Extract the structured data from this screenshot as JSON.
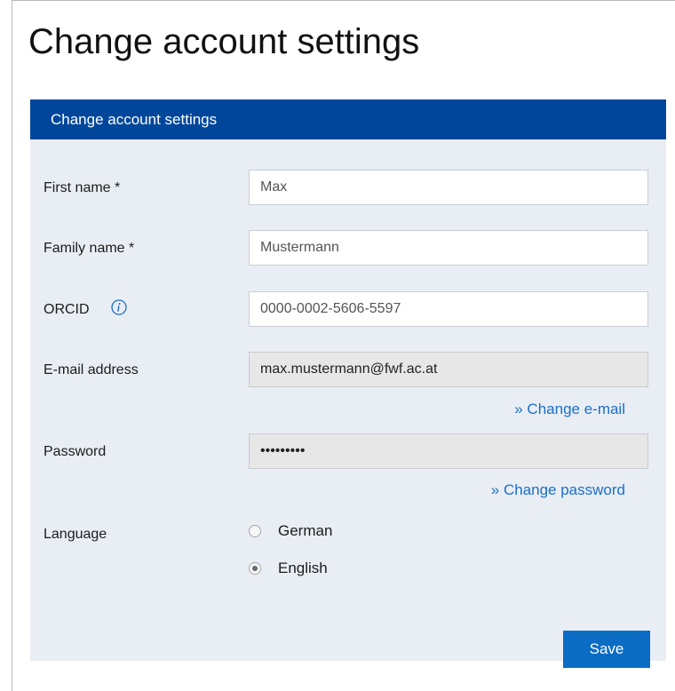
{
  "page": {
    "title": "Change account settings"
  },
  "panel": {
    "header": "Change account settings"
  },
  "form": {
    "first_name": {
      "label": "First name *",
      "value": "Max"
    },
    "family_name": {
      "label": "Family name *",
      "value": "Mustermann"
    },
    "orcid": {
      "label": "ORCID",
      "value": "0000-0002-5606-5597",
      "info_icon": "info-icon"
    },
    "email": {
      "label": "E-mail address",
      "value": "max.mustermann@fwf.ac.at",
      "change_link": "» Change e-mail"
    },
    "password": {
      "label": "Password",
      "value": "•••••••••",
      "change_link": "» Change password"
    },
    "language": {
      "label": "Language",
      "options": [
        {
          "label": "German",
          "selected": false
        },
        {
          "label": "English",
          "selected": true
        }
      ]
    },
    "save_label": "Save"
  },
  "colors": {
    "header_bg": "#00479b",
    "panel_bg": "#e9edf4",
    "link": "#1a6fc9",
    "button_bg": "#0b6cc4"
  }
}
